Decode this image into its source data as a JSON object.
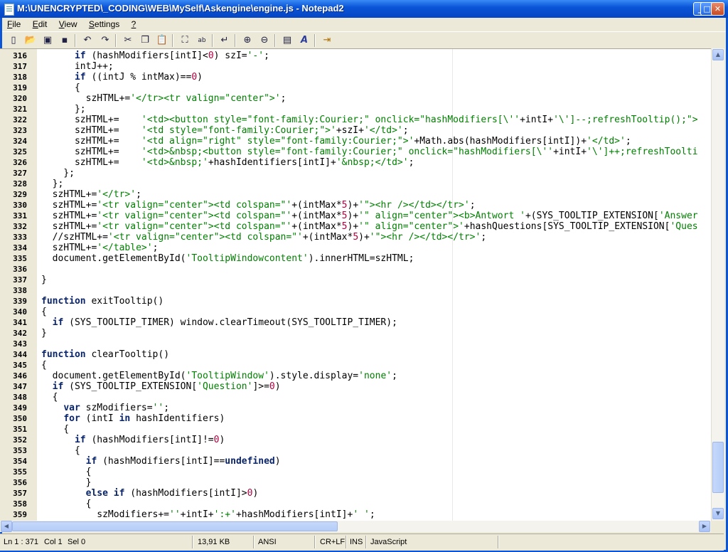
{
  "window": {
    "title": "M:\\UNENCRYPTED\\_CODING\\WEB\\MySelf\\Askengine\\engine.js - Notepad2",
    "minimize_glyph": "_",
    "maximize_glyph": "□",
    "close_glyph": "✕"
  },
  "menu": [
    {
      "accel": "F",
      "rest": "ile"
    },
    {
      "accel": "E",
      "rest": "dit"
    },
    {
      "accel": "V",
      "rest": "iew"
    },
    {
      "accel": "S",
      "rest": "ettings"
    },
    {
      "accel": "?",
      "rest": ""
    }
  ],
  "toolbar": {
    "icons": [
      "new-file-icon",
      "open-file-icon",
      "browse-icon",
      "save-icon",
      "undo-icon",
      "redo-icon",
      "cut-icon",
      "copy-icon",
      "paste-icon",
      "find-icon",
      "replace-icon",
      "word-wrap-icon",
      "zoom-in-icon",
      "zoom-out-icon",
      "schemes-icon",
      "font-icon",
      "exit-icon"
    ],
    "glyphs": {
      "new": "▯",
      "open": "📂",
      "browse": "▣",
      "save": "▪",
      "undo": "↶",
      "redo": "↷",
      "cut": "✂",
      "copy": "❐",
      "paste": "📋",
      "find": "⛶",
      "replace": "ab",
      "wrap": "↵",
      "zoomin": "⊕",
      "zoomout": "⊖",
      "schemes": "▤",
      "font": "A",
      "exit": "⇥"
    }
  },
  "editor": {
    "lines": [
      {
        "n": "316",
        "t": "      if (hashModifiers[intI]<0) szI='-';"
      },
      {
        "n": "317",
        "t": "      intJ++;"
      },
      {
        "n": "318",
        "t": "      if ((intJ % intMax)==0)"
      },
      {
        "n": "319",
        "t": "      {"
      },
      {
        "n": "320",
        "t": "        szHTML+='</tr><tr valign=\"center\">';"
      },
      {
        "n": "321",
        "t": "      };"
      },
      {
        "n": "322",
        "t": "      szHTML+=    '<td><button style=\"font-family:Courier;\" onclick=\"hashModifiers[\\''+intI+'\\']--;refreshTooltip();\">"
      },
      {
        "n": "323",
        "t": "      szHTML+=    '<td style=\"font-family:Courier;\">'+szI+'</td>';"
      },
      {
        "n": "324",
        "t": "      szHTML+=    '<td align=\"right\" style=\"font-family:Courier;\">'+Math.abs(hashModifiers[intI])+'</td>';"
      },
      {
        "n": "325",
        "t": "      szHTML+=    '<td>&nbsp;<button style=\"font-family:Courier;\" onclick=\"hashModifiers[\\''+intI+'\\']++;refreshToolti"
      },
      {
        "n": "326",
        "t": "      szHTML+=    '<td>&nbsp;'+hashIdentifiers[intI]+'&nbsp;</td>';"
      },
      {
        "n": "327",
        "t": "    };"
      },
      {
        "n": "328",
        "t": "  };"
      },
      {
        "n": "329",
        "t": "  szHTML+='</tr>';"
      },
      {
        "n": "330",
        "t": "  szHTML+='<tr valign=\"center\"><td colspan=\"'+(intMax*5)+'\"><hr /></td></tr>';"
      },
      {
        "n": "331",
        "t": "  szHTML+='<tr valign=\"center\"><td colspan=\"'+(intMax*5)+'\" align=\"center\"><b>Antwort '+(SYS_TOOLTIP_EXTENSION['Answer"
      },
      {
        "n": "332",
        "t": "  szHTML+='<tr valign=\"center\"><td colspan=\"'+(intMax*5)+'\" align=\"center\">'+hashQuestions[SYS_TOOLTIP_EXTENSION['Ques"
      },
      {
        "n": "333",
        "t": "  //szHTML+='<tr valign=\"center\"><td colspan=\"'+(intMax*5)+'\"><hr /></td></tr>';"
      },
      {
        "n": "334",
        "t": "  szHTML+='</table>';"
      },
      {
        "n": "335",
        "t": "  document.getElementById('TooltipWindowcontent').innerHTML=szHTML;"
      },
      {
        "n": "336",
        "t": ""
      },
      {
        "n": "337",
        "t": "}"
      },
      {
        "n": "338",
        "t": ""
      },
      {
        "n": "339",
        "t": "function exitTooltip()"
      },
      {
        "n": "340",
        "t": "{"
      },
      {
        "n": "341",
        "t": "  if (SYS_TOOLTIP_TIMER) window.clearTimeout(SYS_TOOLTIP_TIMER);"
      },
      {
        "n": "342",
        "t": "}"
      },
      {
        "n": "343",
        "t": ""
      },
      {
        "n": "344",
        "t": "function clearTooltip()"
      },
      {
        "n": "345",
        "t": "{"
      },
      {
        "n": "346",
        "t": "  document.getElementById('TooltipWindow').style.display='none';"
      },
      {
        "n": "347",
        "t": "  if (SYS_TOOLTIP_EXTENSION['Question']>=0)"
      },
      {
        "n": "348",
        "t": "  {"
      },
      {
        "n": "349",
        "t": "    var szModifiers='';"
      },
      {
        "n": "350",
        "t": "    for (intI in hashIdentifiers)"
      },
      {
        "n": "351",
        "t": "    {"
      },
      {
        "n": "352",
        "t": "      if (hashModifiers[intI]!=0)"
      },
      {
        "n": "353",
        "t": "      {"
      },
      {
        "n": "354",
        "t": "        if (hashModifiers[intI]==undefined)"
      },
      {
        "n": "355",
        "t": "        {"
      },
      {
        "n": "356",
        "t": "        }"
      },
      {
        "n": "357",
        "t": "        else if (hashModifiers[intI]>0)"
      },
      {
        "n": "358",
        "t": "        {"
      },
      {
        "n": "359",
        "t": "          szModifiers+=''+intI+':+'+hashModifiers[intI]+' ';"
      }
    ]
  },
  "scroll": {
    "vertical_fraction": 0.83,
    "horizontal_fraction": 0.0,
    "up_glyph": "▲",
    "down_glyph": "▼",
    "left_glyph": "◀",
    "right_glyph": "▶"
  },
  "status": {
    "position": "Ln 1 : 371",
    "column": "Col 1",
    "selection": "Sel 0",
    "size": "13,91 KB",
    "encoding": "ANSI",
    "line_endings": "CR+LF",
    "mode": "INS",
    "lexer": "JavaScript"
  }
}
